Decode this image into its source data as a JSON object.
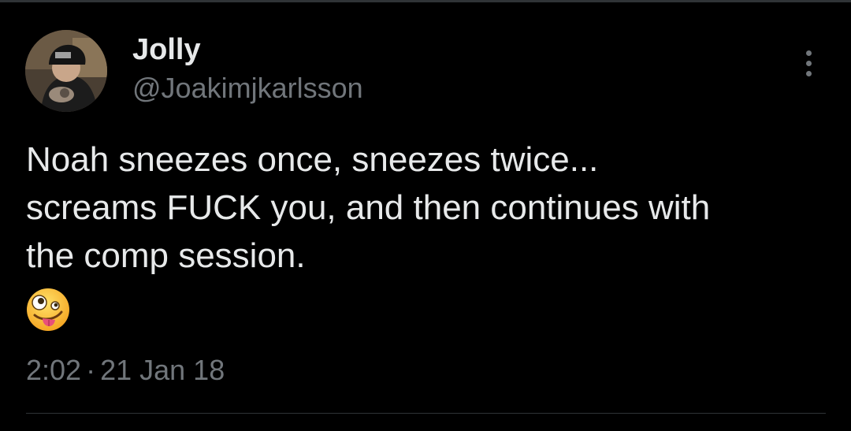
{
  "tweet": {
    "author": {
      "display_name": "Jolly",
      "handle": "@Joakimjkarlsson",
      "avatar_icon": "profile-photo"
    },
    "more_icon": "more-vertical-icon",
    "text_lines": [
      "Noah sneezes once, sneezes twice...",
      "screams FUCK you, and then continues with",
      "the comp session."
    ],
    "emoji": "zany-face-emoji",
    "time": "2:02",
    "separator": "·",
    "date": "21 Jan 18"
  },
  "colors": {
    "background": "#000000",
    "primary_text": "#e7e9ea",
    "secondary_text": "#71767b",
    "divider": "#2f3336"
  }
}
